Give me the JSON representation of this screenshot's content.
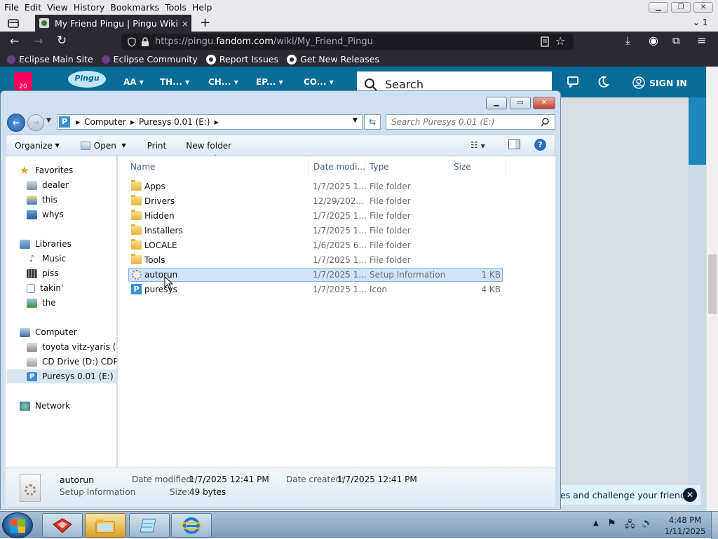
{
  "browser": {
    "menu": [
      "File",
      "Edit",
      "View",
      "History",
      "Bookmarks",
      "Tools",
      "Help"
    ],
    "tab_title": "My Friend Pingu | Pingu Wiki | F",
    "tab_close": "×",
    "new_tab": "+",
    "tab_count": "1",
    "url_prefix": "https://pingu.",
    "url_domain": "fandom.com",
    "url_path": "/wiki/My_Friend_Pingu",
    "bookmarks": [
      "Eclipse Main Site",
      "Eclipse Community",
      "Report Issues",
      "Get New Releases"
    ]
  },
  "fandom": {
    "nav": [
      "AA",
      "TH...",
      "CH...",
      "EP...",
      "CO..."
    ],
    "search_label": "Search",
    "sign_in": "SIGN IN",
    "badge": "20",
    "toast": "es and challenge your friends!"
  },
  "explorer": {
    "breadcrumb": [
      "Computer",
      "Puresys 0.01 (E:)"
    ],
    "search_placeholder": "Search Puresys 0.01 (E:)",
    "toolbar": {
      "organize": "Organize",
      "open": "Open",
      "print": "Print",
      "new_folder": "New folder"
    },
    "nav_pane": {
      "favorites": {
        "label": "Favorites",
        "items": [
          "dealer",
          "this",
          "whys"
        ]
      },
      "libraries": {
        "label": "Libraries",
        "items": [
          "Music",
          "piss",
          "takin'",
          "the"
        ]
      },
      "computer": {
        "label": "Computer",
        "items": [
          "toyota vitz-yaris (sar",
          "CD Drive (D:) CDROM",
          "Puresys 0.01 (E:)"
        ]
      },
      "network": {
        "label": "Network"
      }
    },
    "columns": [
      "Name",
      "Date modi...",
      "Type",
      "Size"
    ],
    "files": [
      {
        "name": "Apps",
        "date": "1/7/2025 1...",
        "type": "File folder",
        "size": ""
      },
      {
        "name": "Drivers",
        "date": "12/29/202...",
        "type": "File folder",
        "size": ""
      },
      {
        "name": "Hidden",
        "date": "1/7/2025 1...",
        "type": "File folder",
        "size": ""
      },
      {
        "name": "Installers",
        "date": "1/7/2025 1...",
        "type": "File folder",
        "size": ""
      },
      {
        "name": "LOCALE",
        "date": "1/6/2025 6...",
        "type": "File folder",
        "size": ""
      },
      {
        "name": "Tools",
        "date": "1/7/2025 1...",
        "type": "File folder",
        "size": ""
      },
      {
        "name": "autorun",
        "date": "1/7/2025 1...",
        "type": "Setup Information",
        "size": "1 KB"
      },
      {
        "name": "puresys",
        "date": "1/7/2025 1...",
        "type": "Icon",
        "size": "4 KB"
      }
    ],
    "details": {
      "name": "autorun",
      "type": "Setup Information",
      "date_modified_label": "Date modified:",
      "date_modified": "1/7/2025 12:41 PM",
      "date_created_label": "Date created:",
      "date_created": "1/7/2025 12:41 PM",
      "size_label": "Size:",
      "size": "49 bytes"
    }
  },
  "taskbar": {
    "time": "4:48 PM",
    "date": "1/11/2025"
  }
}
